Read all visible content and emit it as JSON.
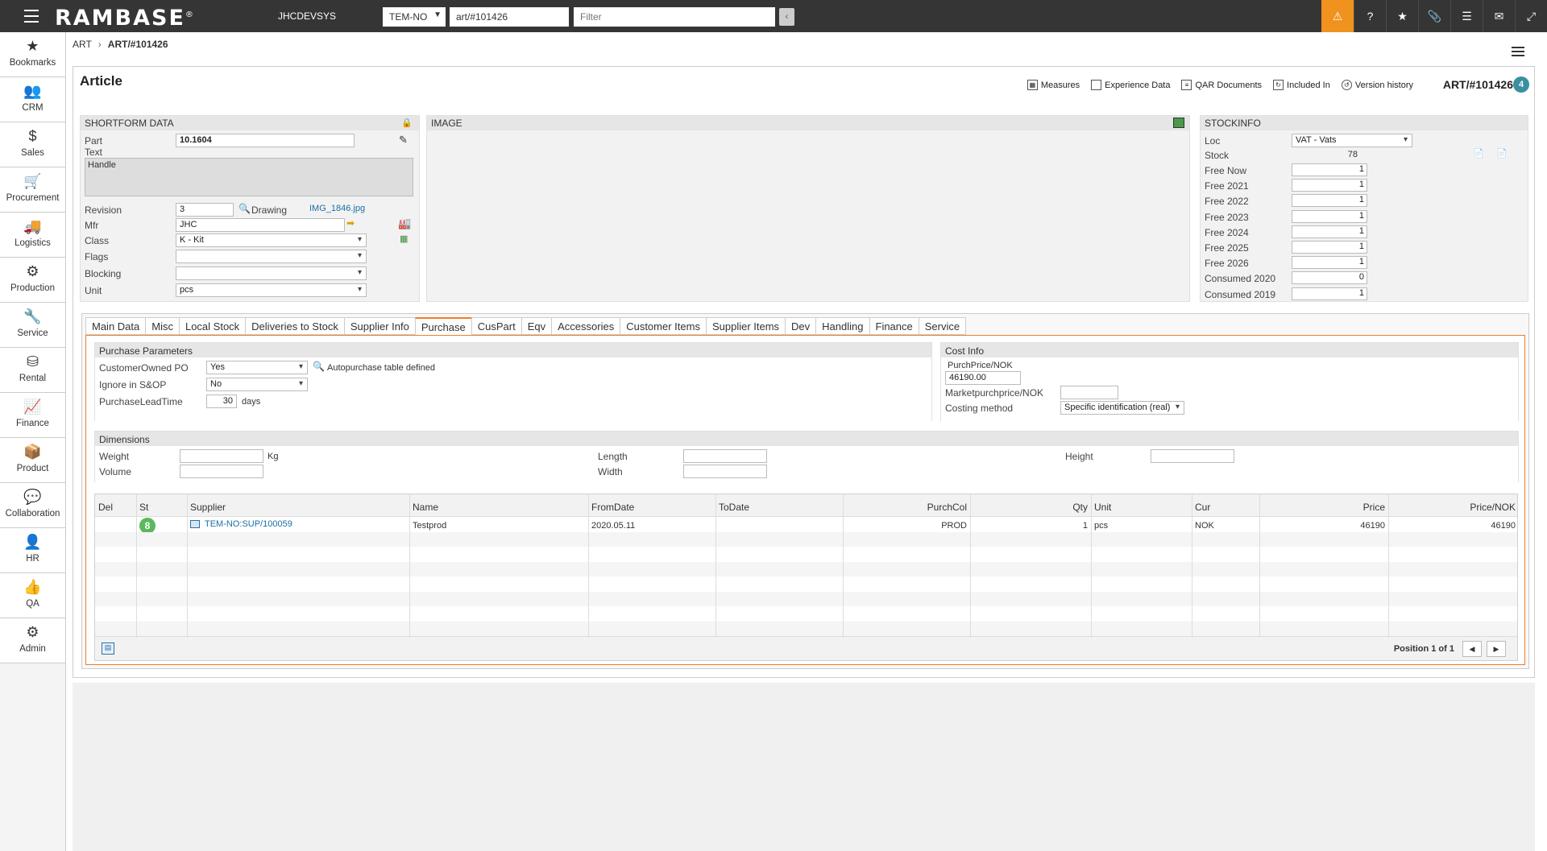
{
  "topbar": {
    "logo": "RAMBASE",
    "logo_mark": "®",
    "system": "JHCDEVSYS",
    "company": "TEM-NO",
    "address": "art/#101426",
    "filter_placeholder": "Filter",
    "icons": [
      "warning-icon",
      "help-icon",
      "star-icon",
      "paperclip-icon",
      "list-icon",
      "mail-icon",
      "expand-icon"
    ]
  },
  "nav": [
    {
      "label": "Bookmarks",
      "icon": "★"
    },
    {
      "label": "CRM",
      "icon": "👥"
    },
    {
      "label": "Sales",
      "icon": "$"
    },
    {
      "label": "Procurement",
      "icon": "🛒"
    },
    {
      "label": "Logistics",
      "icon": "🚚"
    },
    {
      "label": "Production",
      "icon": "⚙"
    },
    {
      "label": "Service",
      "icon": "🔧"
    },
    {
      "label": "Rental",
      "icon": "⛁"
    },
    {
      "label": "Finance",
      "icon": "📈"
    },
    {
      "label": "Product",
      "icon": "📦"
    },
    {
      "label": "Collaboration",
      "icon": "💬"
    },
    {
      "label": "HR",
      "icon": "👤"
    },
    {
      "label": "QA",
      "icon": "👍"
    },
    {
      "label": "Admin",
      "icon": "⚙"
    }
  ],
  "breadcrumb": {
    "root": "ART",
    "sep": "›",
    "current": "ART/#101426"
  },
  "header": {
    "title": "Article",
    "links": [
      "Measures",
      "Experience Data",
      "QAR Documents",
      "Included In",
      "Version history"
    ],
    "art_id": "ART/#101426",
    "badge": "4"
  },
  "shortform": {
    "heading": "SHORTFORM DATA",
    "part_label": "Part",
    "part": "10.1604",
    "text_label": "Text",
    "text": "Handle",
    "revision_label": "Revision",
    "revision": "3",
    "drawing_label": "Drawing",
    "drawing": "IMG_1846.jpg",
    "mfr_label": "Mfr",
    "mfr": "JHC",
    "class_label": "Class",
    "class": "K - Kit",
    "flags_label": "Flags",
    "flags": "",
    "blocking_label": "Blocking",
    "blocking": "",
    "unit_label": "Unit",
    "unit": "pcs"
  },
  "image": {
    "heading": "IMAGE"
  },
  "stockinfo": {
    "heading": "STOCKINFO",
    "loc_label": "Loc",
    "loc": "VAT - Vats",
    "stock_label": "Stock",
    "stock": "78",
    "rows": [
      {
        "label": "Free Now",
        "value": "1"
      },
      {
        "label": "Free 2021",
        "value": "1"
      },
      {
        "label": "Free 2022",
        "value": "1"
      },
      {
        "label": "Free 2023",
        "value": "1"
      },
      {
        "label": "Free 2024",
        "value": "1"
      },
      {
        "label": "Free 2025",
        "value": "1"
      },
      {
        "label": "Free 2026",
        "value": "1"
      },
      {
        "label": "Consumed 2020",
        "value": "0"
      },
      {
        "label": "Consumed 2019",
        "value": "1"
      }
    ]
  },
  "tabs": [
    "Main Data",
    "Misc",
    "Local Stock",
    "Deliveries to Stock",
    "Supplier Info",
    "Purchase",
    "CusPart",
    "Eqv",
    "Accessories",
    "Customer Items",
    "Supplier Items",
    "Dev",
    "Handling",
    "Finance",
    "Service"
  ],
  "active_tab": "Purchase",
  "purchase_params": {
    "heading": "Purchase Parameters",
    "cust_po_label": "CustomerOwned PO",
    "cust_po": "Yes",
    "autopurchase": "Autopurchase table defined",
    "ignore_label": "Ignore in S&OP",
    "ignore": "No",
    "lead_label": "PurchaseLeadTime",
    "lead": "30",
    "lead_unit": "days"
  },
  "cost_info": {
    "heading": "Cost Info",
    "purch_label": "PurchPrice/NOK",
    "purch": "46190.00",
    "market_label": "Marketpurchprice/NOK",
    "market": "",
    "costing_label": "Costing method",
    "costing": "Specific identification (real)"
  },
  "dimensions": {
    "heading": "Dimensions",
    "weight_label": "Weight",
    "weight_unit": "Kg",
    "volume_label": "Volume",
    "length_label": "Length",
    "width_label": "Width",
    "height_label": "Height"
  },
  "grid": {
    "columns": [
      "Del",
      "St",
      "Supplier",
      "Name",
      "FromDate",
      "ToDate",
      "PurchCol",
      "Qty",
      "Unit",
      "Cur",
      "Price",
      "Price/NOK"
    ],
    "rows": [
      {
        "del": "",
        "st": "8",
        "supplier": "TEM-NO:SUP/100059",
        "name": "Testprod",
        "from": "2020.05.11",
        "to": "",
        "purchcol": "PROD",
        "qty": "1",
        "unit": "pcs",
        "cur": "NOK",
        "price": "46190",
        "price_nok": "46190"
      }
    ],
    "position": "Position 1 of 1"
  }
}
